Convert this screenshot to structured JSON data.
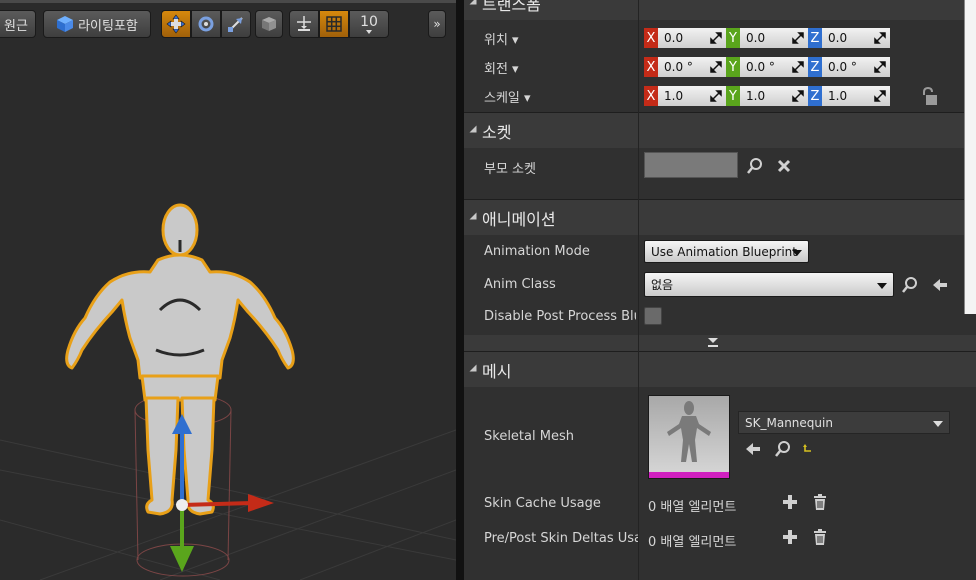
{
  "toolbar": {
    "perspective_label": "원근",
    "lighting_label": "라이팅포함",
    "grid_size": "10",
    "more_icon": "double-chevron-right-icon"
  },
  "details": {
    "transform": {
      "title": "트랜스폼",
      "location_label": "위치",
      "rotation_label": "회전",
      "scale_label": "스케일",
      "location": {
        "x": "0.0",
        "y": "0.0",
        "z": "0.0"
      },
      "rotation": {
        "x": "0.0 °",
        "y": "0.0 °",
        "z": "0.0 °"
      },
      "scale": {
        "x": "1.0",
        "y": "1.0",
        "z": "1.0"
      },
      "axis_x": "X",
      "axis_y": "Y",
      "axis_z": "Z"
    },
    "socket": {
      "title": "소켓",
      "parent_socket_label": "부모 소켓"
    },
    "animation": {
      "title": "애니메이션",
      "mode_label": "Animation Mode",
      "mode_value": "Use Animation Blueprint",
      "anim_class_label": "Anim Class",
      "anim_class_value": "없음",
      "disable_post_label": "Disable Post Process Bluep"
    },
    "mesh": {
      "title": "메시",
      "skeletal_mesh_label": "Skeletal Mesh",
      "skeletal_mesh_value": "SK_Mannequin",
      "skin_cache_label": "Skin Cache Usage",
      "skin_cache_value": "0 배열 엘리먼트",
      "pre_post_label": "Pre/Post Skin Deltas Usage",
      "pre_post_value": "0 배열 엘리먼트"
    }
  },
  "colors": {
    "accent_orange": "#d6890d",
    "axis_x": "#c42b18",
    "axis_y": "#5aa51c",
    "axis_z": "#2f6fd0",
    "selection_outline": "#e8a018",
    "thumbnail_bar": "#d020c0"
  }
}
